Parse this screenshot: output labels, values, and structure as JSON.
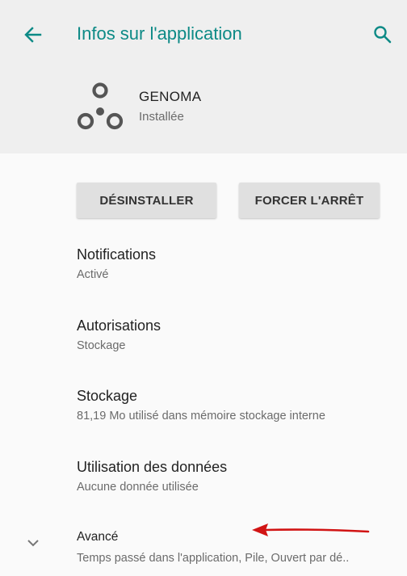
{
  "header": {
    "title": "Infos sur l'application",
    "back_icon": "arrow-left-icon",
    "search_icon": "search-icon",
    "accent_color": "#0d8a86"
  },
  "app": {
    "name": "GENOMA",
    "status": "Installée",
    "logo_icon": "genoma-logo-icon"
  },
  "buttons": {
    "uninstall": "DÉSINSTALLER",
    "force_stop": "FORCER L'ARRÊT"
  },
  "settings": {
    "notifications": {
      "title": "Notifications",
      "subtitle": "Activé"
    },
    "permissions": {
      "title": "Autorisations",
      "subtitle": "Stockage"
    },
    "storage": {
      "title": "Stockage",
      "subtitle": "81,19 Mo utilisé dans mémoire stockage interne"
    },
    "data_usage": {
      "title": "Utilisation des données",
      "subtitle": "Aucune donnée utilisée"
    },
    "advanced": {
      "title": "Avancé",
      "subtitle": "Temps passé dans l'application, Pile, Ouvert par dé..",
      "expand_icon": "chevron-down-icon"
    }
  },
  "annotation": {
    "arrow_color": "#d11414"
  }
}
